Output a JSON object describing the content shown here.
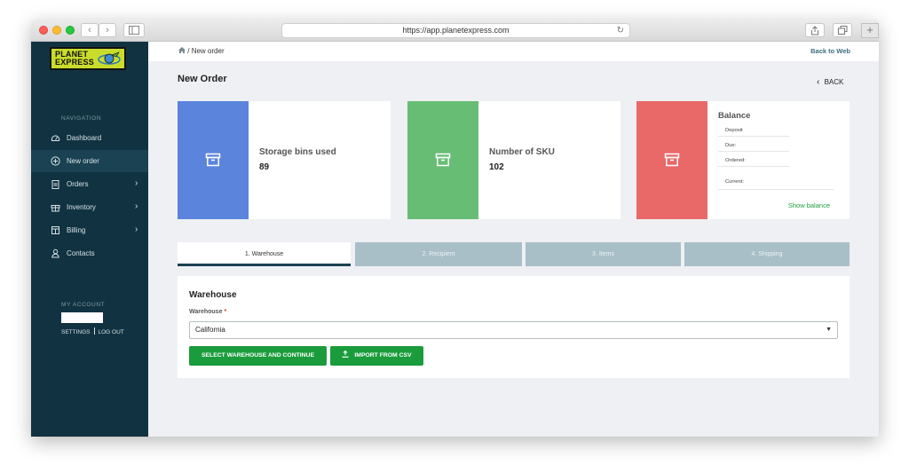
{
  "browser": {
    "url": "https://app.planetexpress.com",
    "nav_back": "‹",
    "nav_forward": "›",
    "reload": "↻",
    "new_tab": "+"
  },
  "logo": {
    "line1": "PLANET",
    "line2": "EXPRESS"
  },
  "sidebar": {
    "heading": "NAVIGATION",
    "items": [
      {
        "label": "Dashboard",
        "icon": "dashboard-icon",
        "active": false,
        "has_children": false
      },
      {
        "label": "New order",
        "icon": "plus-circle-icon",
        "active": true,
        "has_children": false
      },
      {
        "label": "Orders",
        "icon": "clipboard-icon",
        "active": false,
        "has_children": true
      },
      {
        "label": "Inventory",
        "icon": "gift-box-icon",
        "active": false,
        "has_children": true
      },
      {
        "label": "Billing",
        "icon": "billing-icon",
        "active": false,
        "has_children": true
      },
      {
        "label": "Contacts",
        "icon": "person-icon",
        "active": false,
        "has_children": false
      }
    ],
    "chevron": "›"
  },
  "account": {
    "heading": "MY ACCOUNT",
    "settings_label": "SETTINGS",
    "logout_label": "LOG OUT"
  },
  "breadcrumb": {
    "separator": "/",
    "current": "New order"
  },
  "back_to_web": "Back to Web",
  "page_title": "New Order",
  "back_label": "BACK",
  "stats": [
    {
      "label": "Storage bins used",
      "value": "89",
      "color": "#5b84dc"
    },
    {
      "label": "Number of SKU",
      "value": "102",
      "color": "#67bd74"
    }
  ],
  "balance": {
    "title": "Balance",
    "color": "#e96868",
    "rows": [
      "Deposit",
      "Due:",
      "Ordered:"
    ],
    "current_label": "Current:",
    "show_balance": "Show balance"
  },
  "steps": [
    {
      "label": "1. Warehouse",
      "active": true
    },
    {
      "label": "2. Recipient",
      "active": false
    },
    {
      "label": "3. Items",
      "active": false
    },
    {
      "label": "4. Shipping",
      "active": false
    }
  ],
  "warehouse_form": {
    "title": "Warehouse",
    "field_label": "Warehouse",
    "required_mark": "*",
    "selected": "California",
    "primary_button": "SELECT WAREHOUSE AND CONTINUE",
    "import_button": "IMPORT FROM CSV"
  },
  "colors": {
    "sidebar_bg": "#113341",
    "accent_green": "#1a9c3c",
    "tab_inactive": "#a8bfc8"
  }
}
